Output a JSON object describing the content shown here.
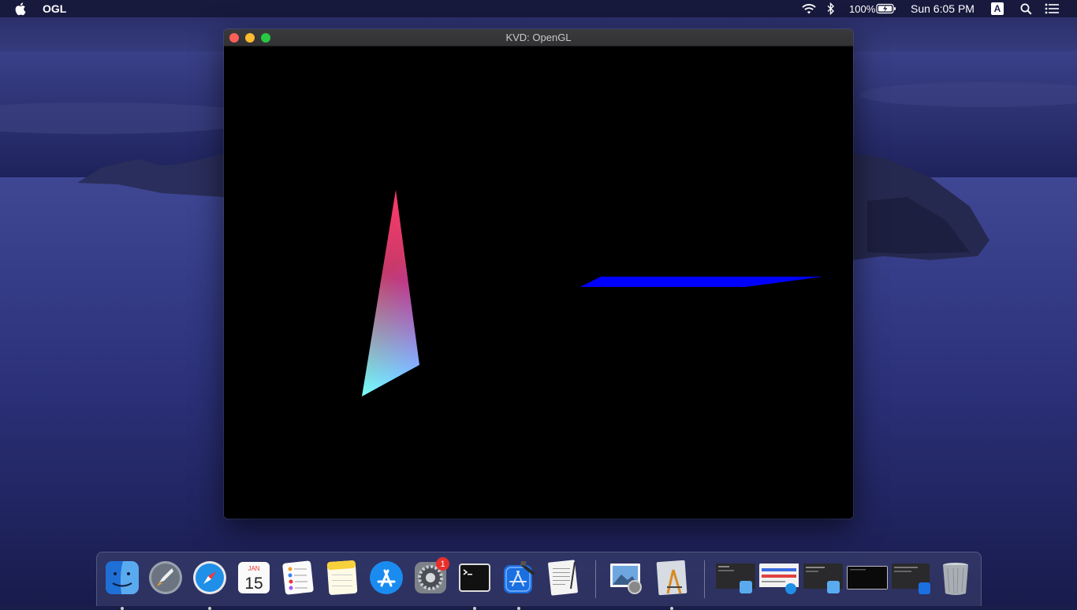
{
  "menubar": {
    "app_name": "OGL",
    "battery_percent": "100%",
    "clock": "Sun 6:05 PM",
    "input_source": "A"
  },
  "window": {
    "title": "KVD: OpenGL"
  },
  "dock": {
    "calendar_month": "JAN",
    "calendar_day": "15",
    "settings_badge": "1",
    "apps": [
      "finder",
      "launchpad",
      "safari",
      "calendar",
      "reminders",
      "notes",
      "app-store",
      "system-preferences",
      "terminal",
      "xcode",
      "textedit",
      "preview",
      "instruments",
      "trash"
    ]
  },
  "colors": {
    "menubar_bg": "#16183a",
    "window_bg": "#000000",
    "quad_blue": "#0000ff",
    "triangle_vertices": [
      "#ff0000",
      "#00ff00",
      "#0000ff"
    ]
  }
}
